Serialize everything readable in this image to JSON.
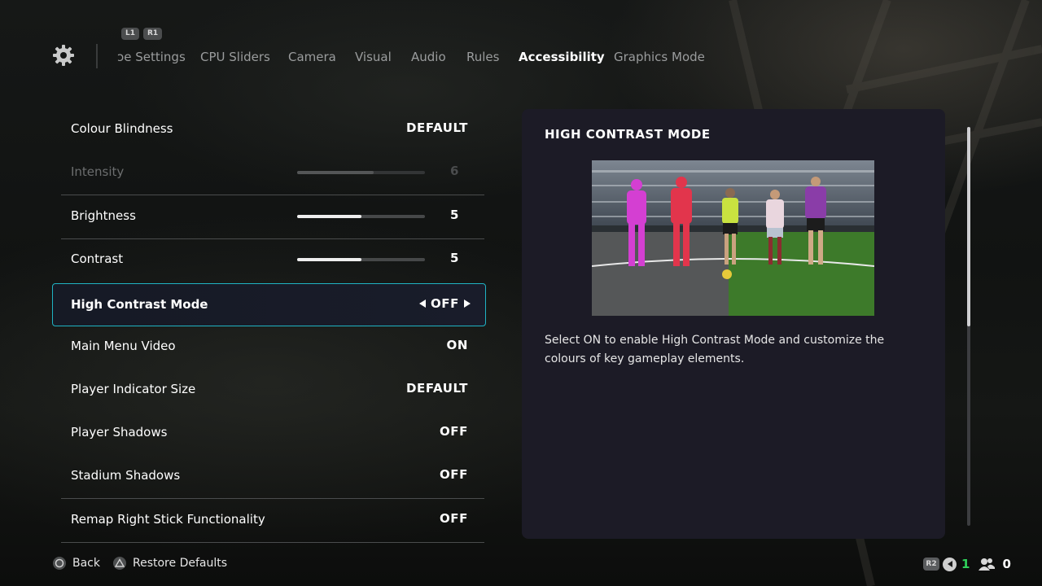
{
  "nav": {
    "left_bumper": "L1",
    "right_bumper": "R1",
    "tabs": [
      "ɔe Settings",
      "CPU Sliders",
      "Camera",
      "Visual",
      "Audio",
      "Rules",
      "Accessibility",
      "Graphics Mode"
    ],
    "active_tab": "Accessibility"
  },
  "settings": [
    {
      "label": "Colour Blindness",
      "value": "DEFAULT"
    },
    {
      "label": "Intensity",
      "value": "6",
      "slider_fraction": 0.6,
      "disabled": true
    },
    {
      "label": "Brightness",
      "value": "5",
      "slider_fraction": 0.5
    },
    {
      "label": "Contrast",
      "value": "5",
      "slider_fraction": 0.5
    },
    {
      "label": "High Contrast Mode",
      "value": "OFF",
      "selected": true
    },
    {
      "label": "Main Menu Video",
      "value": "ON"
    },
    {
      "label": "Player Indicator Size",
      "value": "DEFAULT"
    },
    {
      "label": "Player Shadows",
      "value": "OFF"
    },
    {
      "label": "Stadium Shadows",
      "value": "OFF"
    },
    {
      "label": "Remap Right Stick Functionality",
      "value": "OFF"
    }
  ],
  "panel": {
    "title": "HIGH CONTRAST MODE",
    "description": "Select ON to enable High Contrast Mode and customize the colours of key gameplay elements.",
    "scroll_position_fraction": 0.0
  },
  "footer": {
    "back_label": "Back",
    "restore_label": "Restore Defaults",
    "r2_label": "R2",
    "count_green": "1",
    "count_players": "0"
  },
  "colors": {
    "accent_cyan": "#1fb3c3",
    "panel_bg": "#1c1b26",
    "status_green": "#2fd15a",
    "highlight_magenta": "#d43fd2",
    "highlight_red": "#e2354c"
  },
  "icons": {
    "settings": "gear-icon",
    "back": "circle-button-icon",
    "restore": "triangle-button-icon",
    "players": "players-icon"
  }
}
